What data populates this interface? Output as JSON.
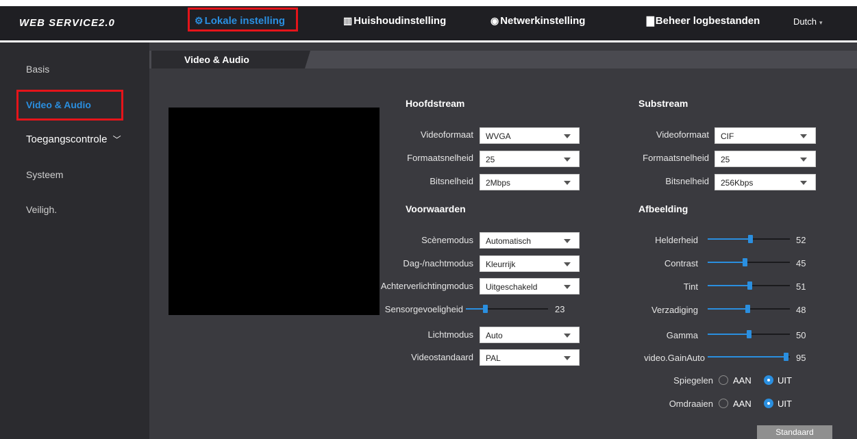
{
  "header": {
    "brand": "WEB SERVICE2.0",
    "nav": [
      {
        "label": "Lokale instelling",
        "icon": "gear-icon",
        "glyph": "⚙"
      },
      {
        "label": "Huishoudinstelling",
        "icon": "building-icon",
        "glyph": "▥"
      },
      {
        "label": "Netwerkinstelling",
        "icon": "globe-icon",
        "glyph": "◉"
      },
      {
        "label": "Beheer logbestanden",
        "icon": "log-icon",
        "glyph": "▇"
      }
    ],
    "language": "Dutch"
  },
  "sidebar": {
    "items": [
      "Basis",
      "Video & Audio",
      "Toegangscontrole",
      "Systeem",
      "Veiligh."
    ],
    "active": "Video & Audio"
  },
  "tab": "Video & Audio",
  "mainstream": {
    "title": "Hoofdstream",
    "videoformat": {
      "label": "Videoformaat",
      "value": "WVGA"
    },
    "framerate": {
      "label": "Formaatsnelheid",
      "value": "25"
    },
    "bitrate": {
      "label": "Bitsnelheid",
      "value": "2Mbps"
    }
  },
  "substream": {
    "title": "Substream",
    "videoformat": {
      "label": "Videoformaat",
      "value": "CIF"
    },
    "framerate": {
      "label": "Formaatsnelheid",
      "value": "25"
    },
    "bitrate": {
      "label": "Bitsnelheid",
      "value": "256Kbps"
    }
  },
  "conditions": {
    "title": "Voorwaarden",
    "scene": {
      "label": "Scènemodus",
      "value": "Automatisch"
    },
    "daynight": {
      "label": "Dag-/nachtmodus",
      "value": "Kleurrijk"
    },
    "backlight": {
      "label": "Achterverlichtingmodus",
      "value": "Uitgeschakeld"
    },
    "sensitivity": {
      "label": "Sensorgevoeligheid",
      "value": "23"
    },
    "lightmode": {
      "label": "Lichtmodus",
      "value": "Auto"
    },
    "videostandard": {
      "label": "Videostandaard",
      "value": "PAL"
    }
  },
  "image": {
    "title": "Afbeelding",
    "brightness": {
      "label": "Helderheid",
      "value": "52"
    },
    "contrast": {
      "label": "Contrast",
      "value": "45"
    },
    "hue": {
      "label": "Tint",
      "value": "51"
    },
    "saturation": {
      "label": "Verzadiging",
      "value": "48"
    },
    "gamma": {
      "label": "Gamma",
      "value": "50"
    },
    "gainauto": {
      "label": "video.GainAuto",
      "value": "95"
    },
    "mirror": {
      "label": "Spiegelen",
      "on": "AAN",
      "off": "UIT",
      "selected": "UIT"
    },
    "flip": {
      "label": "Omdraaien",
      "on": "AAN",
      "off": "UIT",
      "selected": "UIT"
    }
  },
  "buttons": {
    "default": "Standaard"
  },
  "colors": {
    "accent": "#2a8fe0",
    "highlight": "#e5141a",
    "background": "#3a3a3f"
  }
}
